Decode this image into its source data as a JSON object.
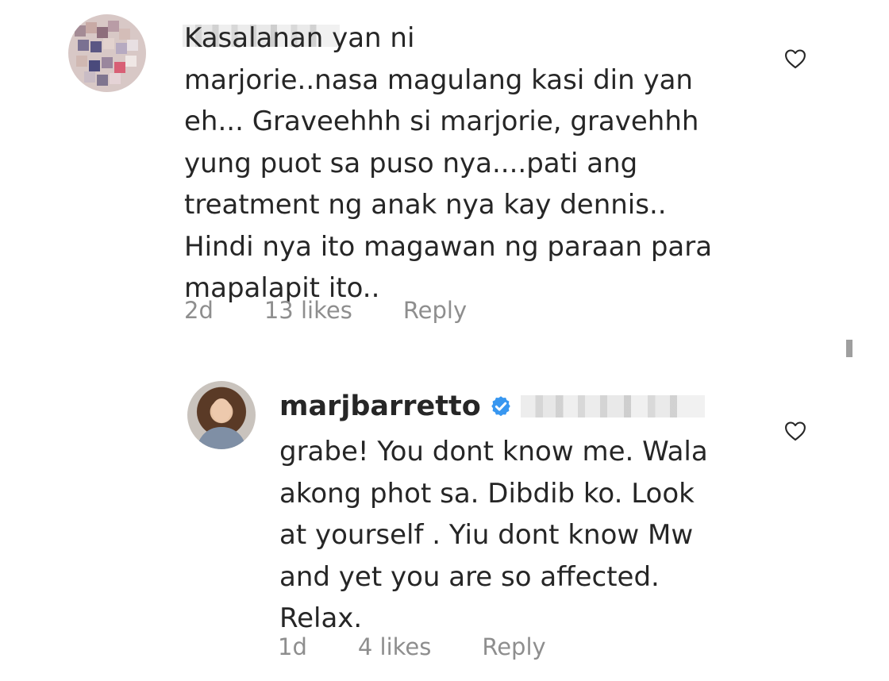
{
  "comments": [
    {
      "text": "Kasalanan yan ni\nmarjorie..nasa magulang kasi din yan\neh... Graveehhh si marjorie, gravehhh\nyung puot sa puso nya....pati ang\ntreatment ng anak nya kay dennis..\nHindi nya ito magawan ng paraan para\nmapalapit ito..",
      "time": "2d",
      "likes": "13 likes",
      "reply": "Reply"
    },
    {
      "username": "marjbarretto",
      "text": "grabe! You dont know me. Wala\nakong phot sa. Dibdib ko. Look\nat yourself . Yiu dont know Mw\nand yet you are so affected.\nRelax.",
      "time": "1d",
      "likes": "4 likes",
      "reply": "Reply"
    }
  ],
  "icons": {
    "heart": "heart-icon",
    "verified": "verified-badge-icon"
  },
  "colors": {
    "text": "#262626",
    "meta": "#8e8e8e",
    "verified": "#3897f0",
    "background": "#ffffff"
  }
}
